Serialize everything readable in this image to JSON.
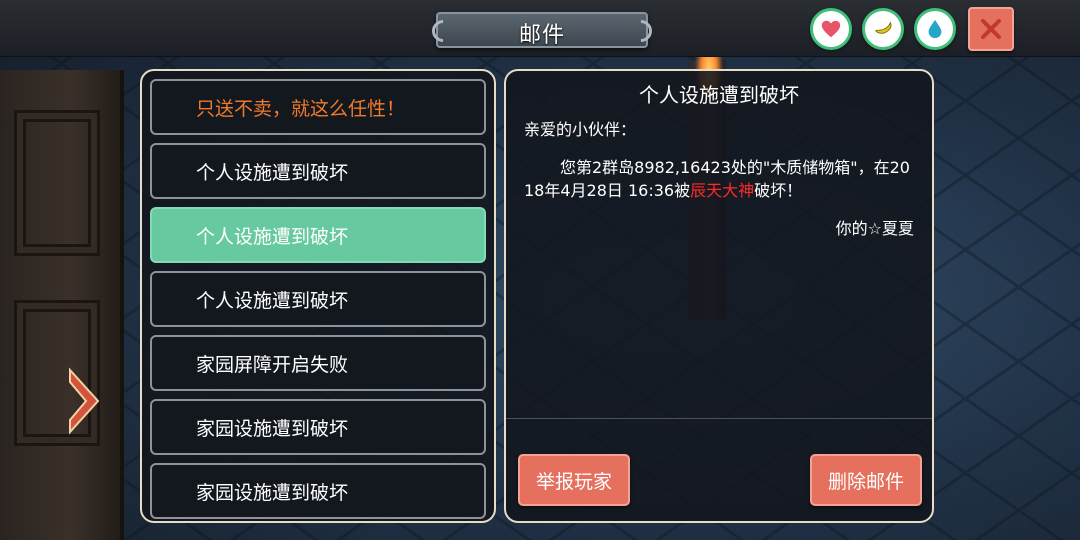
{
  "window": {
    "title": "邮件"
  },
  "status_buttons": [
    {
      "icon": "heart-icon",
      "color": "#e8546a"
    },
    {
      "icon": "banana-icon",
      "color": "#e2c61a"
    },
    {
      "icon": "water-drop-icon",
      "color": "#26a7c9"
    }
  ],
  "close_icon": "close-icon",
  "mail_list": {
    "items": [
      {
        "label": "只送不卖，就这么任性！",
        "state": "special"
      },
      {
        "label": "个人设施遭到破坏",
        "state": "normal"
      },
      {
        "label": "个人设施遭到破坏",
        "state": "selected"
      },
      {
        "label": "个人设施遭到破坏",
        "state": "normal"
      },
      {
        "label": "家园屏障开启失败",
        "state": "normal"
      },
      {
        "label": "家园设施遭到破坏",
        "state": "normal"
      },
      {
        "label": "家园设施遭到破坏",
        "state": "normal"
      }
    ]
  },
  "mail_detail": {
    "title": "个人设施遭到破坏",
    "greeting": "亲爱的小伙伴：",
    "body_before": "您第2群岛8982,16423处的\"木质储物箱\"，在2018年4月28日 16:36被",
    "body_highlight": "辰天大神",
    "body_after": "破坏！",
    "signature": "你的☆夏夏",
    "report_button": "举报玩家",
    "delete_button": "删除邮件"
  },
  "colors": {
    "selected_item": "#67c9a0",
    "special_item_text": "#f07a2c",
    "highlight_text": "#ff2a2a",
    "action_button": "#e5705e",
    "panel_border": "#e6dcc8"
  }
}
